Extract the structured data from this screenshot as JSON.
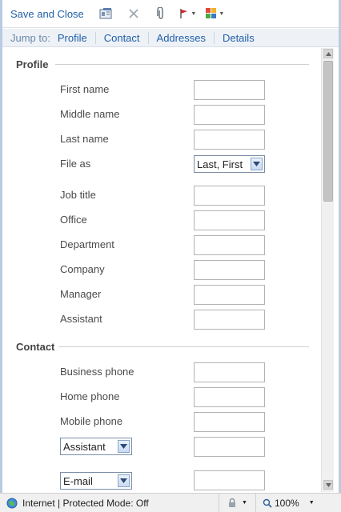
{
  "toolbar": {
    "save_close_label": "Save and Close"
  },
  "icons": {
    "save": "contact-card-icon",
    "delete": "delete-x-icon",
    "attach": "paperclip-icon",
    "flag": "flag-icon",
    "categories": "categories-grid-icon"
  },
  "jump": {
    "label": "Jump to:",
    "links": [
      "Profile",
      "Contact",
      "Addresses",
      "Details"
    ]
  },
  "profile": {
    "title": "Profile",
    "first_name": "First name",
    "middle_name": "Middle name",
    "last_name": "Last name",
    "file_as": "File as",
    "file_as_value": "Last, First",
    "job_title": "Job title",
    "office": "Office",
    "department": "Department",
    "company": "Company",
    "manager": "Manager",
    "assistant": "Assistant"
  },
  "contact": {
    "title": "Contact",
    "business_phone": "Business phone",
    "home_phone": "Home phone",
    "mobile_phone": "Mobile phone",
    "phone_type_value": "Assistant",
    "email_type_value": "E-mail"
  },
  "status": {
    "zone": "Internet | Protected Mode: Off",
    "zoom": "100%"
  },
  "colors": {
    "link": "#1f5fa6",
    "jump_bar": "#eef2f7"
  }
}
